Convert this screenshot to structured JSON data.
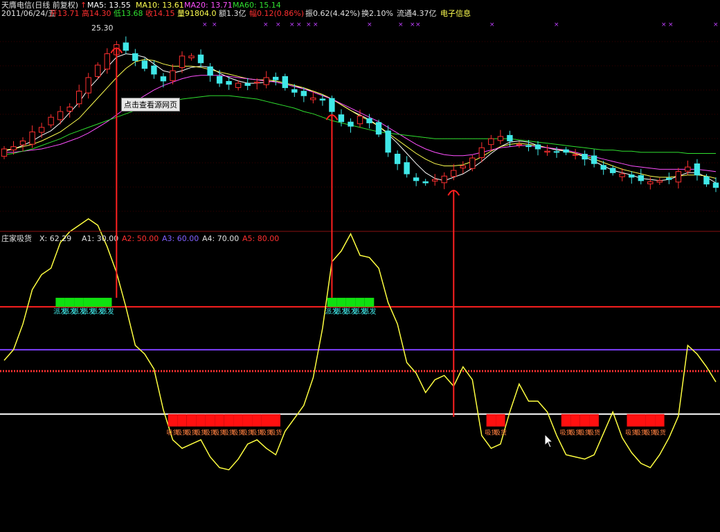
{
  "header": {
    "name": "天膺电信(日线 前复权)",
    "ma5_label": "MA5: 13.55",
    "ma10_label": "MA10: 13.61",
    "ma20_label": "MA20: 13.71",
    "ma60_label": "MA60: 15.14"
  },
  "info": {
    "date": "2011/06/24/五",
    "open": "开13.71",
    "high": "高14.30",
    "low": "低13.68",
    "close": "收14.15",
    "volume": "量91804.0",
    "amount": "额1.3亿",
    "change": "幅0.12(0.86%)",
    "amplitude": "振0.62(4.42%)",
    "turnover": "换2.10%",
    "float": "流通4.37亿",
    "sector": "电子信息"
  },
  "tooltip": "点击查看源网页",
  "peak_label": "25.30",
  "indicator": {
    "name": "庄家吸货",
    "x": "X: 62.29",
    "a1": "A1: 30.00",
    "a2": "A2: 50.00",
    "a3": "A3: 60.00",
    "a4": "A4: 70.00",
    "a5": "A5: 80.00",
    "sell_mark": "派发",
    "buy_mark": "吸货"
  },
  "colors": {
    "up": "#ff3030",
    "down": "#40e8e8",
    "ma5": "#ffffff",
    "ma10": "#ffff50",
    "ma20": "#ff50ff",
    "ma60": "#30e030",
    "osc": "#ffff40",
    "a1": "#ffffff",
    "a2": "#ff3030",
    "a3": "#8040ff",
    "a5": "#ff2020"
  },
  "chart_data": [
    {
      "type": "candlestick",
      "title": "天膺电信(日线 前复权)",
      "ylim": [
        9.2,
        26.2
      ],
      "close_series": [
        15.5,
        15.7,
        16.2,
        17.0,
        17.4,
        18.3,
        18.8,
        19.2,
        20.6,
        21.8,
        22.9,
        23.9,
        24.7,
        24.2,
        23.3,
        22.6,
        22.1,
        21.5,
        22.4,
        23.7,
        23.7,
        23.1,
        22.0,
        21.3,
        21.2,
        21.3,
        21.1,
        21.4,
        21.8,
        21.6,
        20.9,
        20.5,
        20.2,
        20.0,
        19.8,
        18.8,
        17.9,
        17.5,
        18.4,
        17.8,
        16.8,
        15.2,
        14.2,
        13.3,
        12.7,
        12.5,
        12.8,
        13.1,
        13.6,
        14.0,
        14.7,
        15.6,
        16.4,
        16.6,
        16.2,
        15.9,
        15.7,
        15.5,
        15.3,
        15.2,
        15.2,
        15.0,
        14.6,
        14.2,
        13.7,
        13.4,
        13.3,
        13.0,
        12.7,
        12.6,
        12.7,
        12.8,
        13.5,
        13.9,
        13.2,
        12.4,
        12.1
      ],
      "series": [
        {
          "name": "MA5",
          "values": [
            15.3,
            15.5,
            15.8,
            16.2,
            16.7,
            17.1,
            17.8,
            18.7,
            19.6,
            20.8,
            21.7,
            22.7,
            23.6,
            23.9,
            23.8,
            23.6,
            23.0,
            22.4,
            22.2,
            22.4,
            22.7,
            22.8,
            22.7,
            22.2,
            21.8,
            21.5,
            21.3,
            21.3,
            21.4,
            21.5,
            21.3,
            21.1,
            20.8,
            20.6,
            20.3,
            19.9,
            19.4,
            18.9,
            18.5,
            18.1,
            17.5,
            16.8,
            16.0,
            15.1,
            14.2,
            13.4,
            12.9,
            12.7,
            13.0,
            13.3,
            13.8,
            14.4,
            15.1,
            15.7,
            16.1,
            16.2,
            16.1,
            15.8,
            15.6,
            15.4,
            15.3,
            15.1,
            14.8,
            14.4,
            14.0,
            13.6,
            13.4,
            13.2,
            12.9,
            12.8,
            12.7,
            12.8,
            13.1,
            13.4,
            13.4,
            13.0,
            12.5
          ]
        },
        {
          "name": "MA10",
          "values": [
            15.4,
            15.5,
            15.7,
            15.9,
            16.2,
            16.6,
            17.0,
            17.6,
            18.2,
            19.1,
            20.0,
            20.9,
            21.8,
            22.6,
            23.2,
            23.4,
            23.3,
            23.0,
            22.8,
            22.8,
            22.8,
            22.7,
            22.5,
            22.3,
            22.1,
            21.9,
            21.7,
            21.6,
            21.6,
            21.5,
            21.3,
            21.1,
            20.9,
            20.6,
            20.3,
            19.9,
            19.4,
            18.9,
            18.4,
            18.0,
            17.5,
            16.9,
            16.3,
            15.7,
            15.1,
            14.6,
            14.2,
            14.0,
            14.0,
            14.1,
            14.4,
            14.8,
            15.3,
            15.7,
            15.9,
            16.0,
            15.9,
            15.8,
            15.6,
            15.5,
            15.3,
            15.1,
            14.9,
            14.6,
            14.3,
            14.0,
            13.7,
            13.5,
            13.3,
            13.1,
            13.0,
            13.0,
            13.1,
            13.2,
            13.2,
            13.1,
            12.9
          ]
        },
        {
          "name": "MA20",
          "values": [
            15.2,
            15.2,
            15.3,
            15.4,
            15.5,
            15.7,
            15.9,
            16.2,
            16.5,
            16.9,
            17.4,
            17.9,
            18.5,
            19.1,
            19.7,
            20.2,
            20.7,
            21.1,
            21.4,
            21.7,
            21.9,
            22.0,
            22.0,
            22.0,
            21.9,
            21.8,
            21.7,
            21.6,
            21.5,
            21.4,
            21.2,
            21.0,
            20.8,
            20.5,
            20.2,
            19.9,
            19.5,
            19.1,
            18.7,
            18.3,
            17.9,
            17.4,
            16.9,
            16.4,
            15.9,
            15.5,
            15.2,
            15.0,
            14.9,
            14.9,
            15.0,
            15.2,
            15.4,
            15.6,
            15.7,
            15.8,
            15.8,
            15.7,
            15.6,
            15.5,
            15.4,
            15.2,
            15.0,
            14.8,
            14.6,
            14.4,
            14.2,
            14.0,
            13.9,
            13.8,
            13.7,
            13.7,
            13.7,
            13.7,
            13.7,
            13.6,
            13.5
          ]
        },
        {
          "name": "MA60",
          "values": [
            15.0,
            15.1,
            15.3,
            15.5,
            15.8,
            16.1,
            16.4,
            16.8,
            17.1,
            17.4,
            17.7,
            18.0,
            18.3,
            18.6,
            18.9,
            19.1,
            19.3,
            19.5,
            19.7,
            19.9,
            20.0,
            20.1,
            20.2,
            20.2,
            20.2,
            20.1,
            20.0,
            19.9,
            19.7,
            19.5,
            19.3,
            19.1,
            18.8,
            18.6,
            18.3,
            18.0,
            17.8,
            17.6,
            17.4,
            17.2,
            17.0,
            16.9,
            16.8,
            16.7,
            16.6,
            16.5,
            16.4,
            16.4,
            16.4,
            16.4,
            16.4,
            16.4,
            16.4,
            16.4,
            16.4,
            16.3,
            16.2,
            16.1,
            16.0,
            15.9,
            15.8,
            15.7,
            15.6,
            15.5,
            15.4,
            15.4,
            15.3,
            15.3,
            15.2,
            15.2,
            15.2,
            15.2,
            15.2,
            15.1,
            15.1,
            15.1,
            15.1
          ]
        }
      ]
    },
    {
      "type": "line",
      "title": "庄家吸货",
      "ylim": [
        -25,
        110
      ],
      "series": [
        {
          "name": "X",
          "values": [
            55,
            60,
            72,
            88,
            95,
            98,
            110,
            115,
            118,
            121,
            118,
            108,
            96,
            80,
            62,
            58,
            51,
            32,
            18,
            14,
            16,
            18,
            10,
            5,
            4,
            9,
            16,
            18,
            14,
            11,
            22,
            28,
            34,
            47,
            70,
            101,
            106,
            114,
            104,
            103,
            98,
            82,
            72,
            54,
            49,
            40,
            46,
            48,
            43,
            52,
            46,
            20,
            14,
            16,
            31,
            44,
            36,
            36,
            31,
            20,
            11,
            10,
            9,
            11,
            21,
            31,
            19,
            12,
            7,
            5,
            11,
            19,
            29,
            62,
            58,
            52,
            45
          ]
        }
      ],
      "levels": [
        {
          "name": "A1",
          "value": 30
        },
        {
          "name": "A2",
          "value": 50
        },
        {
          "name": "A3",
          "value": 60
        },
        {
          "name": "A4",
          "value": 70
        },
        {
          "name": "A5",
          "value": 80
        }
      ]
    }
  ]
}
